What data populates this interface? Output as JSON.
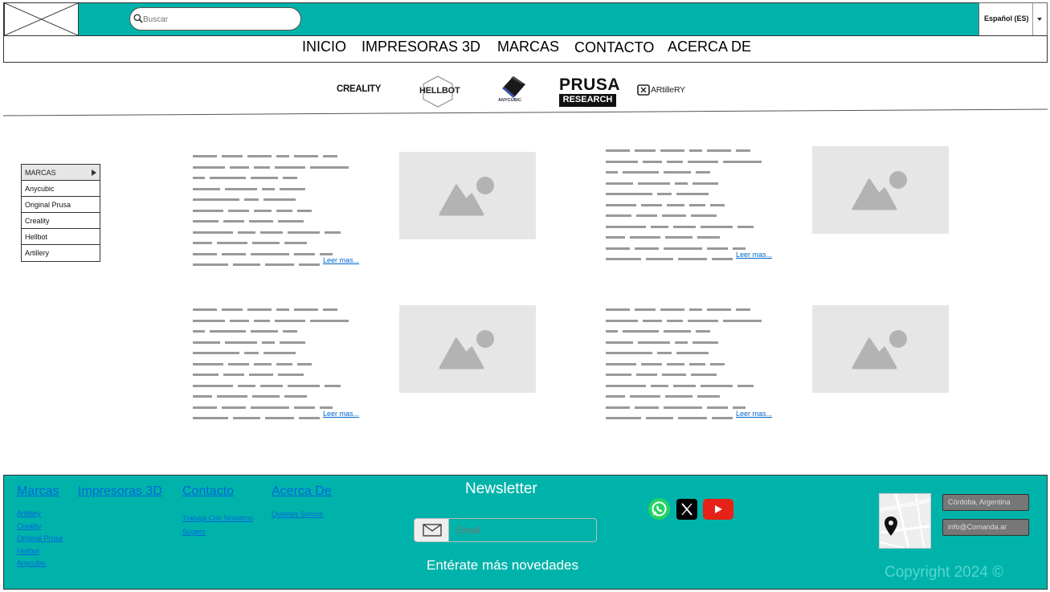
{
  "header": {
    "search_placeholder": "Buscar",
    "language": "Español (ES)"
  },
  "nav": {
    "items": [
      "INICIO",
      "IMPRESORAS 3D",
      "MARCAS",
      "CONTACTO",
      "ACERCA DE"
    ]
  },
  "brands": {
    "creality": "CREALITY",
    "hellbot": "HELLBOT",
    "anycubic": "ANYCUBIC",
    "prusa_top": "PRUSA",
    "prusa_bottom": "RESEARCH",
    "artillery": "ARtilleRY"
  },
  "sidebar": {
    "title": "MARCAS",
    "items": [
      "Anycubic",
      "Original Prusa",
      "Creality",
      "Hellbot",
      "Artillery"
    ]
  },
  "articles": {
    "read_more": "Leer mas..."
  },
  "footer": {
    "columns": [
      {
        "title": "Marcas",
        "links": [
          "Artillery",
          "Creality",
          "Original Prusa",
          "Hellbot",
          "Anycubic"
        ]
      },
      {
        "title": "Impresoras 3D",
        "links": []
      },
      {
        "title": "Contacto",
        "links": [
          "Trabaja Con Nosotros",
          "Sugerir"
        ]
      },
      {
        "title": "Acerca De",
        "links": [
          "Quienes Somos"
        ]
      }
    ],
    "newsletter_title": "Newsletter",
    "email_placeholder": "Email",
    "newsletter_subtitle": "Entérate más novedades",
    "location": "Córdoba, Argentina",
    "email": "info@Comanda.ar",
    "copyright": "Copyright 2024 ©"
  },
  "colors": {
    "teal": "#00b3aa",
    "link": "#0066dd",
    "placeholder": "#e6e6e6",
    "whatsapp": "#25d366",
    "youtube": "#e62117"
  }
}
